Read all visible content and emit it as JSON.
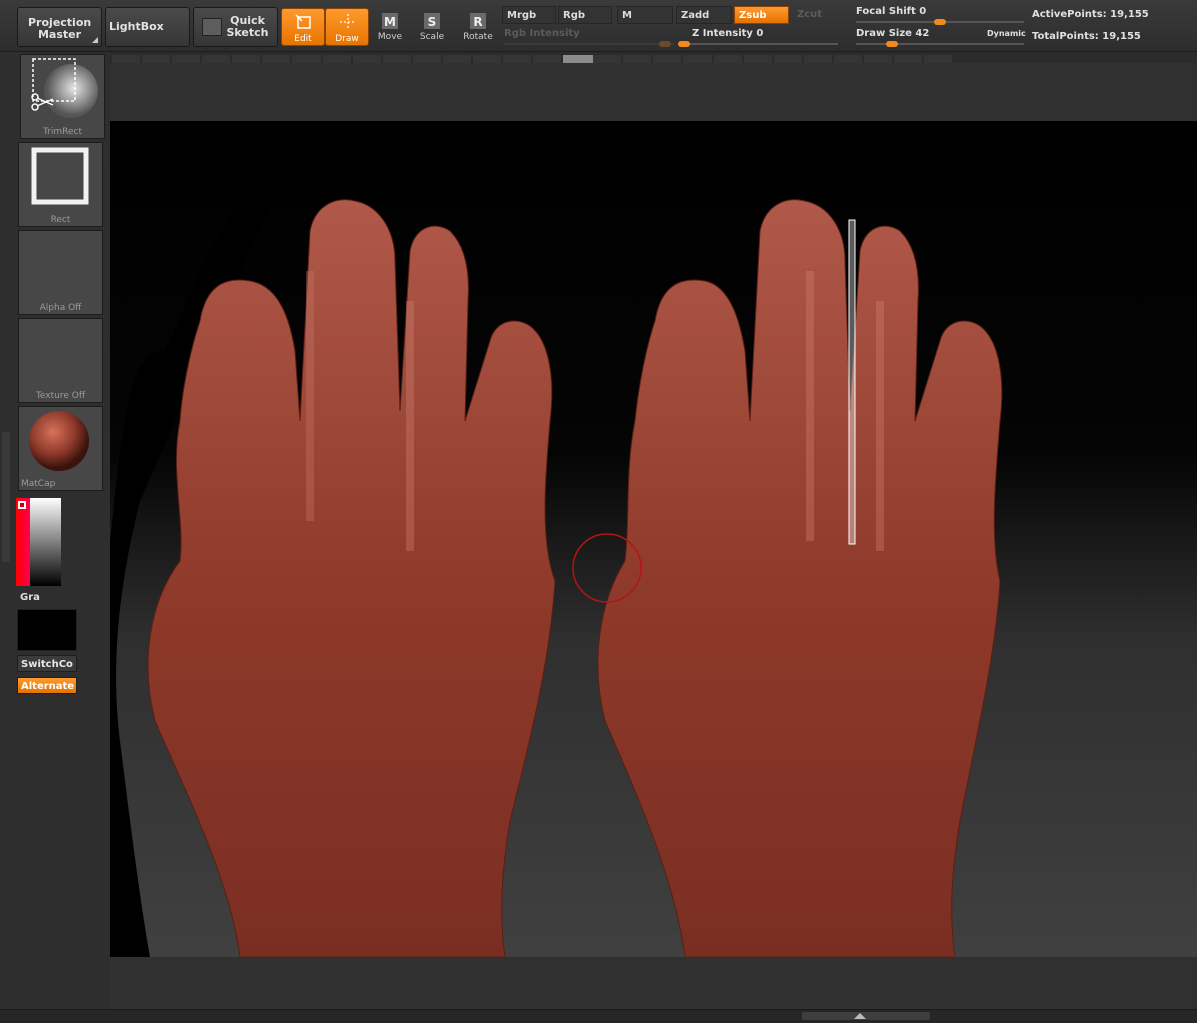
{
  "toolbar": {
    "projection_master": "Projection Master",
    "lightbox": "LightBox",
    "quick_sketch": "Quick Sketch",
    "tools": [
      {
        "label": "Edit",
        "icon": "edit-icon",
        "active": true
      },
      {
        "label": "Draw",
        "icon": "draw-icon",
        "active": true
      },
      {
        "label": "Move",
        "icon": "move-icon",
        "active": false
      },
      {
        "label": "Scale",
        "icon": "scale-icon",
        "active": false
      },
      {
        "label": "Rotate",
        "icon": "rotate-icon",
        "active": false
      }
    ],
    "modes": [
      {
        "label": "Mrgb",
        "state": "off"
      },
      {
        "label": "Rgb",
        "state": "off"
      },
      {
        "label": "M",
        "state": "off"
      },
      {
        "label": "Zadd",
        "state": "off"
      },
      {
        "label": "Zsub",
        "state": "on"
      },
      {
        "label": "Zcut",
        "state": "disabled"
      }
    ],
    "rgb_intensity_label": "Rgb Intensity",
    "z_intensity_label": "Z Intensity",
    "z_intensity_value": "0",
    "focal_shift_label": "Focal Shift",
    "focal_shift_value": "0",
    "draw_size_label": "Draw Size",
    "draw_size_value": "42",
    "dynamic_label": "Dynamic",
    "active_points_label": "ActivePoints:",
    "active_points_value": "19,155",
    "total_points_label": "TotalPoints:",
    "total_points_value": "19,155"
  },
  "shelf": {
    "brush_label": "TrimRect",
    "stroke_label": "Rect",
    "alpha_label": "Alpha Off",
    "texture_label": "Texture Off",
    "material_label": "MatCap",
    "gradient_label": "Gra",
    "switch_color_label": "SwitchCo",
    "alternate_label": "Alternate"
  },
  "colors": {
    "accent": "#f08a1a",
    "skin": "#8f3a2a",
    "background_dark": "#000000",
    "background_gray": "#404040"
  }
}
